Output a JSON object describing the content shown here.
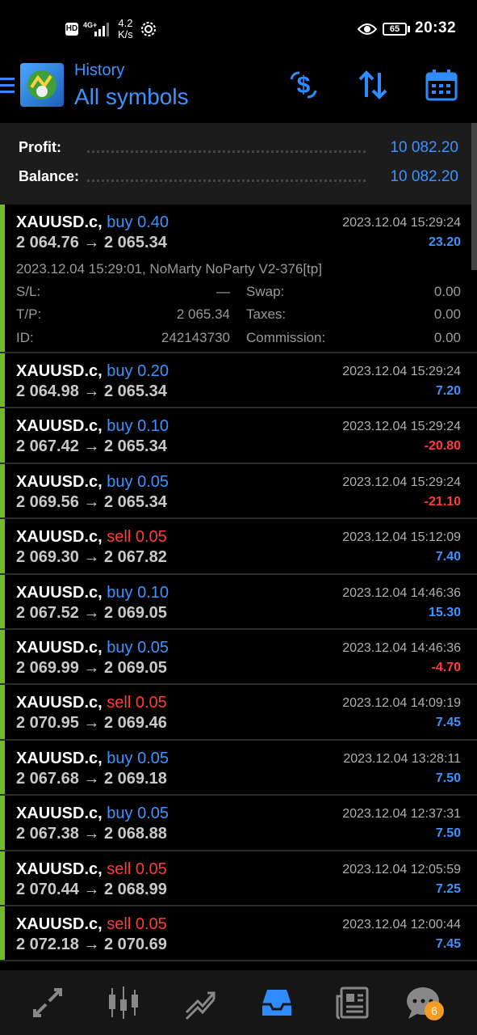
{
  "status_bar": {
    "hd": "HD",
    "network": "4G+",
    "speed_value": "4.2",
    "speed_unit": "K/s",
    "battery": "65",
    "time": "20:32"
  },
  "header": {
    "title": "History",
    "subtitle": "All symbols",
    "icons": [
      "menu-icon",
      "app-logo",
      "deposit-icon",
      "sort-icon",
      "calendar-icon"
    ]
  },
  "summary": {
    "profit_label": "Profit:",
    "profit_value": "10 082.20",
    "balance_label": "Balance:",
    "balance_value": "10 082.20"
  },
  "expanded_trade": {
    "symbol": "XAUUSD.c,",
    "type": "buy 0.40",
    "prices": "2 064.76 → 2 065.34",
    "time": "2023.12.04 15:29:24",
    "profit": "23.20",
    "comment": "2023.12.04 15:29:01, NoMarty NoParty V2-376[tp]",
    "sl_label": "S/L:",
    "sl_value": "—",
    "tp_label": "T/P:",
    "tp_value": "2 065.34",
    "id_label": "ID:",
    "id_value": "242143730",
    "swap_label": "Swap:",
    "swap_value": "0.00",
    "taxes_label": "Taxes:",
    "taxes_value": "0.00",
    "commission_label": "Commission:",
    "commission_value": "0.00"
  },
  "trades": [
    {
      "symbol": "XAUUSD.c,",
      "type": "buy 0.20",
      "side": "buy",
      "prices": "2 064.98 → 2 065.34",
      "time": "2023.12.04 15:29:24",
      "profit": "7.20",
      "sign": "pos"
    },
    {
      "symbol": "XAUUSD.c,",
      "type": "buy 0.10",
      "side": "buy",
      "prices": "2 067.42 → 2 065.34",
      "time": "2023.12.04 15:29:24",
      "profit": "-20.80",
      "sign": "neg"
    },
    {
      "symbol": "XAUUSD.c,",
      "type": "buy 0.05",
      "side": "buy",
      "prices": "2 069.56 → 2 065.34",
      "time": "2023.12.04 15:29:24",
      "profit": "-21.10",
      "sign": "neg"
    },
    {
      "symbol": "XAUUSD.c,",
      "type": "sell 0.05",
      "side": "sell",
      "prices": "2 069.30 → 2 067.82",
      "time": "2023.12.04 15:12:09",
      "profit": "7.40",
      "sign": "pos"
    },
    {
      "symbol": "XAUUSD.c,",
      "type": "buy 0.10",
      "side": "buy",
      "prices": "2 067.52 → 2 069.05",
      "time": "2023.12.04 14:46:36",
      "profit": "15.30",
      "sign": "pos"
    },
    {
      "symbol": "XAUUSD.c,",
      "type": "buy 0.05",
      "side": "buy",
      "prices": "2 069.99 → 2 069.05",
      "time": "2023.12.04 14:46:36",
      "profit": "-4.70",
      "sign": "neg"
    },
    {
      "symbol": "XAUUSD.c,",
      "type": "sell 0.05",
      "side": "sell",
      "prices": "2 070.95 → 2 069.46",
      "time": "2023.12.04 14:09:19",
      "profit": "7.45",
      "sign": "pos"
    },
    {
      "symbol": "XAUUSD.c,",
      "type": "buy 0.05",
      "side": "buy",
      "prices": "2 067.68 → 2 069.18",
      "time": "2023.12.04 13:28:11",
      "profit": "7.50",
      "sign": "pos"
    },
    {
      "symbol": "XAUUSD.c,",
      "type": "buy 0.05",
      "side": "buy",
      "prices": "2 067.38 → 2 068.88",
      "time": "2023.12.04 12:37:31",
      "profit": "7.50",
      "sign": "pos"
    },
    {
      "symbol": "XAUUSD.c,",
      "type": "sell 0.05",
      "side": "sell",
      "prices": "2 070.44 → 2 068.99",
      "time": "2023.12.04 12:05:59",
      "profit": "7.25",
      "sign": "pos"
    },
    {
      "symbol": "XAUUSD.c,",
      "type": "sell 0.05",
      "side": "sell",
      "prices": "2 072.18 → 2 070.69",
      "time": "2023.12.04 12:00:44",
      "profit": "7.45",
      "sign": "pos"
    }
  ],
  "bottom_nav": {
    "items": [
      "quotes-icon",
      "chart-icon",
      "trade-icon",
      "history-icon",
      "news-icon",
      "chat-icon"
    ],
    "chat_badge": "6"
  },
  "colors": {
    "accent_blue": "#3d93ff",
    "loss_red": "#ff3b3b",
    "trade_accent": "#74b92a",
    "badge": "#f39c24"
  }
}
